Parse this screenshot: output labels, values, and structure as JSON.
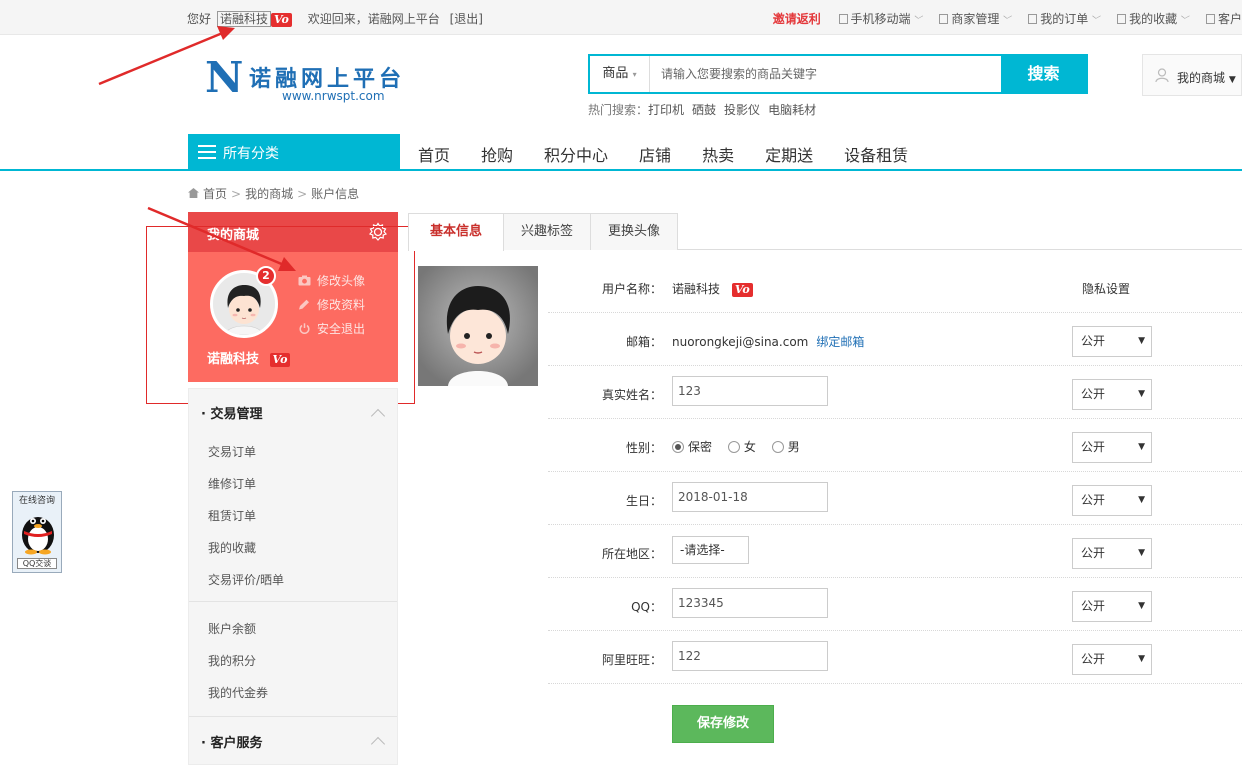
{
  "topbar": {
    "greeting": "您好",
    "username": "诺融科技",
    "vo": "Vo",
    "welcome": "欢迎回来，诺融网上平台",
    "logout": "[退出]",
    "invite": "邀请返利",
    "mobile": "手机移动端",
    "merchant": "商家管理",
    "orders": "我的订单",
    "favorites": "我的收藏",
    "service": "客户"
  },
  "header": {
    "logo_letter": "N",
    "logo_text": "诺融网上平台",
    "logo_url": "www.nrwspt.com",
    "search_category": "商品",
    "search_placeholder": "请输入您要搜索的商品关键字",
    "search_button": "搜索",
    "hot_label": "热门搜索：",
    "hot_keywords": [
      "打印机",
      "硒鼓",
      "投影仪",
      "电脑耗材"
    ],
    "my_mall": "我的商城"
  },
  "nav": {
    "all_categories": "所有分类",
    "items": [
      "首页",
      "抢购",
      "积分中心",
      "店铺",
      "热卖",
      "定期送",
      "设备租赁"
    ]
  },
  "breadcrumb": [
    "首页",
    "我的商城",
    "账户信息"
  ],
  "sidebar": {
    "title": "我的商城",
    "badge": "2",
    "actions": [
      "修改头像",
      "修改资料",
      "安全退出"
    ],
    "username": "诺融科技",
    "vo": "Vo",
    "sections": [
      {
        "title": "· 交易管理",
        "items": [
          "交易订单",
          "维修订单",
          "租赁订单",
          "我的收藏",
          "交易评价/晒单"
        ]
      },
      {
        "title": "",
        "items": [
          "账户余额",
          "我的积分",
          "我的代金券"
        ]
      },
      {
        "title": "· 客户服务",
        "items": []
      }
    ]
  },
  "qq_widget": {
    "title": "在线咨询",
    "button": "QQ交谈"
  },
  "tabs": [
    "基本信息",
    "兴趣标签",
    "更换头像"
  ],
  "form": {
    "privacy_header": "隐私设置",
    "rows": [
      {
        "label": "用户名称：",
        "value": "诺融科技",
        "vo": "Vo"
      },
      {
        "label": "邮箱：",
        "value": "nuorongkeji@sina.com",
        "link": "绑定邮箱",
        "privacy": "公开"
      },
      {
        "label": "真实姓名：",
        "value": "123",
        "privacy": "公开"
      },
      {
        "label": "性别：",
        "options": [
          "保密",
          "女",
          "男"
        ],
        "selected": "保密",
        "privacy": "公开"
      },
      {
        "label": "生日：",
        "value": "2018-01-18",
        "privacy": "公开"
      },
      {
        "label": "所在地区：",
        "value": "-请选择-",
        "privacy": "公开"
      },
      {
        "label": "QQ：",
        "value": "123345",
        "privacy": "公开"
      },
      {
        "label": "阿里旺旺：",
        "value": "122",
        "privacy": "公开"
      }
    ],
    "save_button": "保存修改"
  },
  "colors": {
    "accent": "#00b7d3",
    "panel_red": "#fd6b61",
    "panel_top": "#e94848",
    "save_green": "#5cb85c",
    "annotation_red": "#e02a2a"
  }
}
